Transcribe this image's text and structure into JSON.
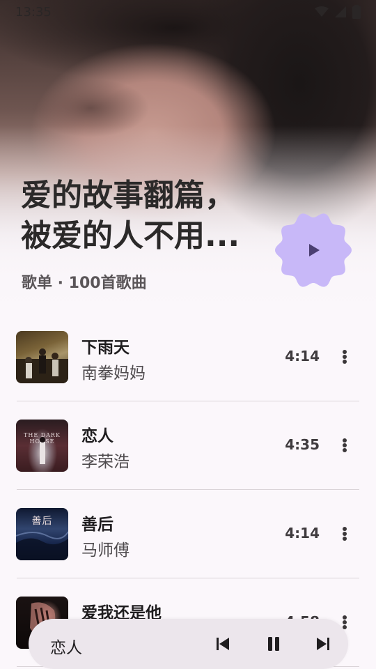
{
  "status_bar": {
    "time": "13:35",
    "icons": [
      "wifi-icon",
      "signal-icon",
      "battery-icon"
    ]
  },
  "playlist": {
    "title": "爱的故事翻篇，被爱的人不用...",
    "subtitle": "歌单 · 100首歌曲",
    "play_icon": "play-icon",
    "accent": "#c8b8f8"
  },
  "songs": [
    {
      "title": "下雨天",
      "artist": "南拳妈妈",
      "duration": "4:14"
    },
    {
      "title": "恋人",
      "artist": "李荣浩",
      "duration": "4:35",
      "cover_text": "THE DARK HORSE"
    },
    {
      "title": "善后",
      "artist": "马师傅",
      "duration": "4:14",
      "cover_text": "善后"
    },
    {
      "title": "爱我还是他",
      "artist": "",
      "duration": "4:58"
    }
  ],
  "mini_player": {
    "title": "恋人",
    "icons": [
      "skip-previous-icon",
      "pause-icon",
      "skip-next-icon"
    ]
  }
}
